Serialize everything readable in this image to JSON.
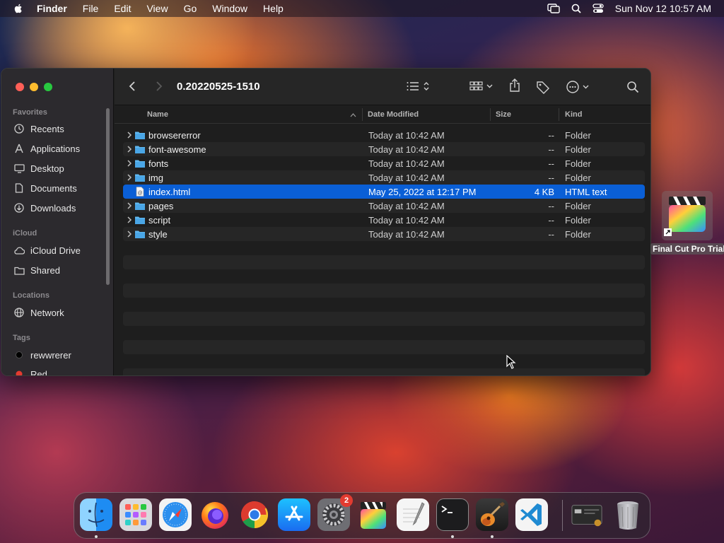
{
  "menubar": {
    "app": "Finder",
    "items": [
      "File",
      "Edit",
      "View",
      "Go",
      "Window",
      "Help"
    ],
    "clock": "Sun Nov 12  10:57 AM"
  },
  "window": {
    "title": "0.20220525-1510",
    "sidebar": {
      "favorites_label": "Favorites",
      "favorites": [
        {
          "label": "Recents",
          "icon": "clock-icon"
        },
        {
          "label": "Applications",
          "icon": "applications-icon"
        },
        {
          "label": "Desktop",
          "icon": "desktop-icon"
        },
        {
          "label": "Documents",
          "icon": "document-icon"
        },
        {
          "label": "Downloads",
          "icon": "download-icon"
        }
      ],
      "icloud_label": "iCloud",
      "icloud": [
        {
          "label": "iCloud Drive",
          "icon": "cloud-icon"
        },
        {
          "label": "Shared",
          "icon": "shared-folder-icon"
        }
      ],
      "locations_label": "Locations",
      "locations": [
        {
          "label": "Network",
          "icon": "globe-icon"
        }
      ],
      "tags_label": "Tags",
      "tags": [
        {
          "label": "rewwrerer",
          "color": "#000000"
        },
        {
          "label": "Red",
          "color": "#e23b30"
        }
      ]
    },
    "columns": {
      "name": "Name",
      "date": "Date Modified",
      "size": "Size",
      "kind": "Kind"
    },
    "files": [
      {
        "name": "browsererror",
        "date": "Today at 10:42 AM",
        "size": "--",
        "kind": "Folder",
        "type": "folder"
      },
      {
        "name": "font-awesome",
        "date": "Today at 10:42 AM",
        "size": "--",
        "kind": "Folder",
        "type": "folder"
      },
      {
        "name": "fonts",
        "date": "Today at 10:42 AM",
        "size": "--",
        "kind": "Folder",
        "type": "folder"
      },
      {
        "name": "img",
        "date": "Today at 10:42 AM",
        "size": "--",
        "kind": "Folder",
        "type": "folder"
      },
      {
        "name": "index.html",
        "date": "May 25, 2022 at 12:17 PM",
        "size": "4 KB",
        "kind": "HTML text",
        "type": "html",
        "selected": true
      },
      {
        "name": "pages",
        "date": "Today at 10:42 AM",
        "size": "--",
        "kind": "Folder",
        "type": "folder"
      },
      {
        "name": "script",
        "date": "Today at 10:42 AM",
        "size": "--",
        "kind": "Folder",
        "type": "folder"
      },
      {
        "name": "style",
        "date": "Today at 10:42 AM",
        "size": "--",
        "kind": "Folder",
        "type": "folder"
      }
    ]
  },
  "desktop": {
    "icon_label": "Final Cut Pro Trial",
    "icon": "final-cut-pro-icon"
  },
  "dock": {
    "apps": [
      {
        "name": "finder-icon",
        "running": true
      },
      {
        "name": "launchpad-icon",
        "running": false
      },
      {
        "name": "safari-icon",
        "running": false
      },
      {
        "name": "firefox-icon",
        "running": false
      },
      {
        "name": "chrome-icon",
        "running": false
      },
      {
        "name": "app-store-icon",
        "running": false
      },
      {
        "name": "system-settings-icon",
        "running": false,
        "badge": "2"
      },
      {
        "name": "final-cut-pro-icon",
        "running": false
      },
      {
        "name": "textedit-icon",
        "running": false
      },
      {
        "name": "terminal-icon",
        "running": true
      },
      {
        "name": "garageband-icon",
        "running": true
      },
      {
        "name": "vscode-icon",
        "running": false
      }
    ],
    "trash": "trash-icon"
  },
  "colors": {
    "selection": "#0a5fd6",
    "folder": "#5fb8f0",
    "close": "#ff5f57",
    "minimize": "#febc2e",
    "zoom": "#28c840"
  }
}
